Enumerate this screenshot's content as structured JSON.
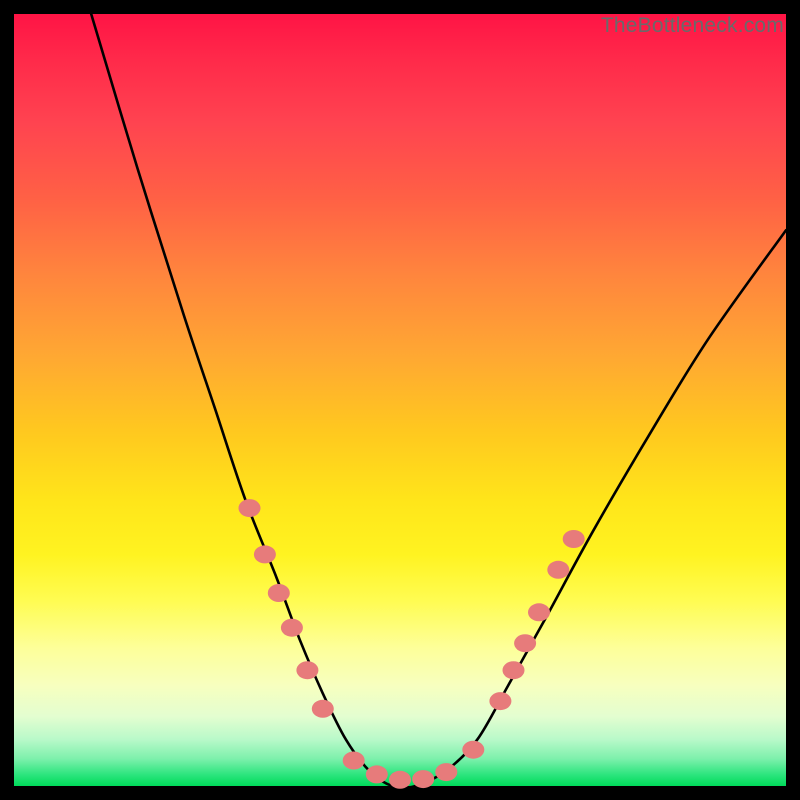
{
  "watermark": "TheBottleneck.com",
  "chart_data": {
    "type": "line",
    "title": "",
    "xlabel": "",
    "ylabel": "",
    "xlim": [
      0,
      100
    ],
    "ylim": [
      0,
      100
    ],
    "grid": false,
    "series": [
      {
        "name": "bottleneck-curve",
        "x": [
          10,
          16,
          22,
          26,
          30,
          34,
          37,
          40,
          43,
          46,
          49,
          52,
          56,
          60,
          64,
          69,
          75,
          82,
          90,
          100
        ],
        "values": [
          100,
          80,
          61,
          49,
          37,
          27,
          19,
          12,
          6,
          2,
          0,
          0,
          2,
          6,
          13,
          22,
          33,
          45,
          58,
          72
        ]
      }
    ],
    "markers": {
      "name": "highlight-dots",
      "color": "#e77b7b",
      "points": [
        {
          "x": 30.5,
          "y": 36
        },
        {
          "x": 32.5,
          "y": 30
        },
        {
          "x": 34.3,
          "y": 25
        },
        {
          "x": 36.0,
          "y": 20.5
        },
        {
          "x": 38.0,
          "y": 15
        },
        {
          "x": 40.0,
          "y": 10
        },
        {
          "x": 44.0,
          "y": 3.3
        },
        {
          "x": 47.0,
          "y": 1.5
        },
        {
          "x": 50.0,
          "y": 0.8
        },
        {
          "x": 53.0,
          "y": 0.9
        },
        {
          "x": 56.0,
          "y": 1.8
        },
        {
          "x": 59.5,
          "y": 4.7
        },
        {
          "x": 63.0,
          "y": 11
        },
        {
          "x": 64.7,
          "y": 15
        },
        {
          "x": 66.2,
          "y": 18.5
        },
        {
          "x": 68.0,
          "y": 22.5
        },
        {
          "x": 70.5,
          "y": 28
        },
        {
          "x": 72.5,
          "y": 32
        }
      ]
    },
    "background_gradient": {
      "top": "#ff1445",
      "mid": "#ffe51a",
      "bottom": "#00db5a"
    }
  }
}
